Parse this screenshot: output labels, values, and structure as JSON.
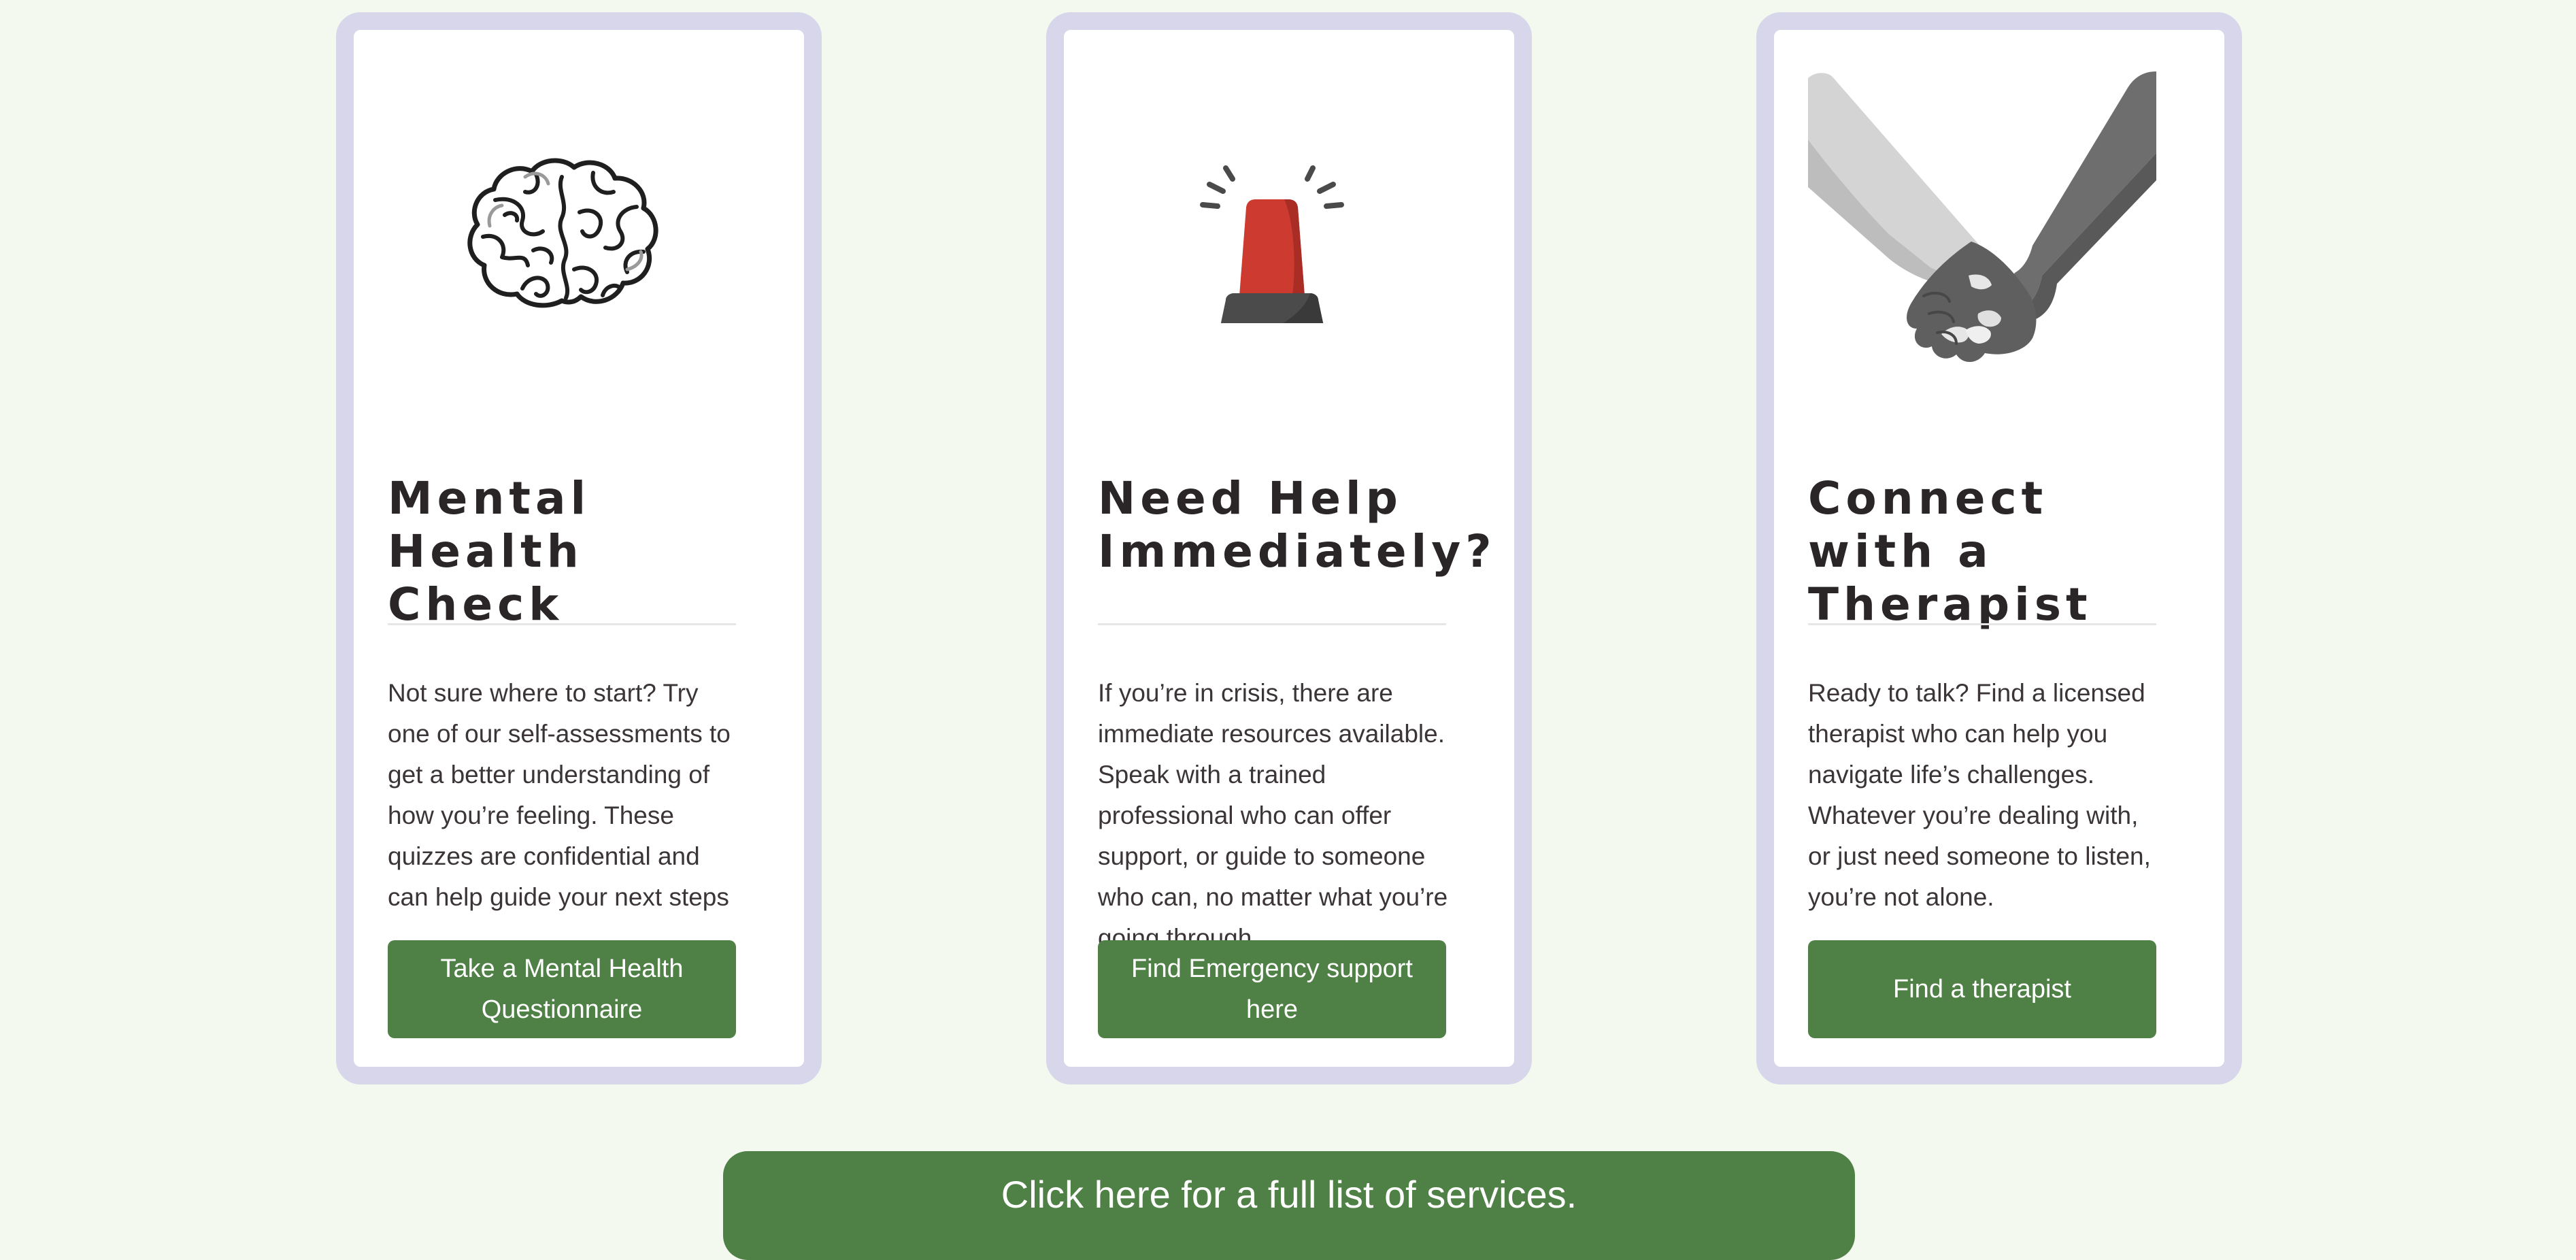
{
  "cards": [
    {
      "title": "Mental Health Check",
      "image_icon": "brain-icon",
      "text": "Not sure where to start? Try one of our self-assessments to get a better understanding of how you’re feeling. These quizzes are confidential and can help guide your next steps",
      "button_label": "Take a Mental Health Questionnaire"
    },
    {
      "title": "Need Help Immediately?",
      "image_icon": "emergency-siren-icon",
      "text": "If you’re in crisis, there are immediate resources available. Speak with a trained professional who can offer support, or guide to someone who can, no matter what you’re going through.",
      "button_label": "Find Emergency support here"
    },
    {
      "title": "Connect with a Therapist",
      "image_icon": "holding-hands-icon",
      "text": "Ready to talk? Find a licensed therapist who can help you navigate life’s challenges. Whatever you’re dealing with, or just need someone to listen, you’re not alone.",
      "button_label": "Find a therapist"
    }
  ],
  "services_button_label": "Click here for a full list of services.",
  "colors": {
    "page_background": "#f3f9ef",
    "card_border": "#d7d6eb",
    "button_green": "#4f8045",
    "title_text": "#2a2628",
    "siren_red": "#cc3a30"
  }
}
